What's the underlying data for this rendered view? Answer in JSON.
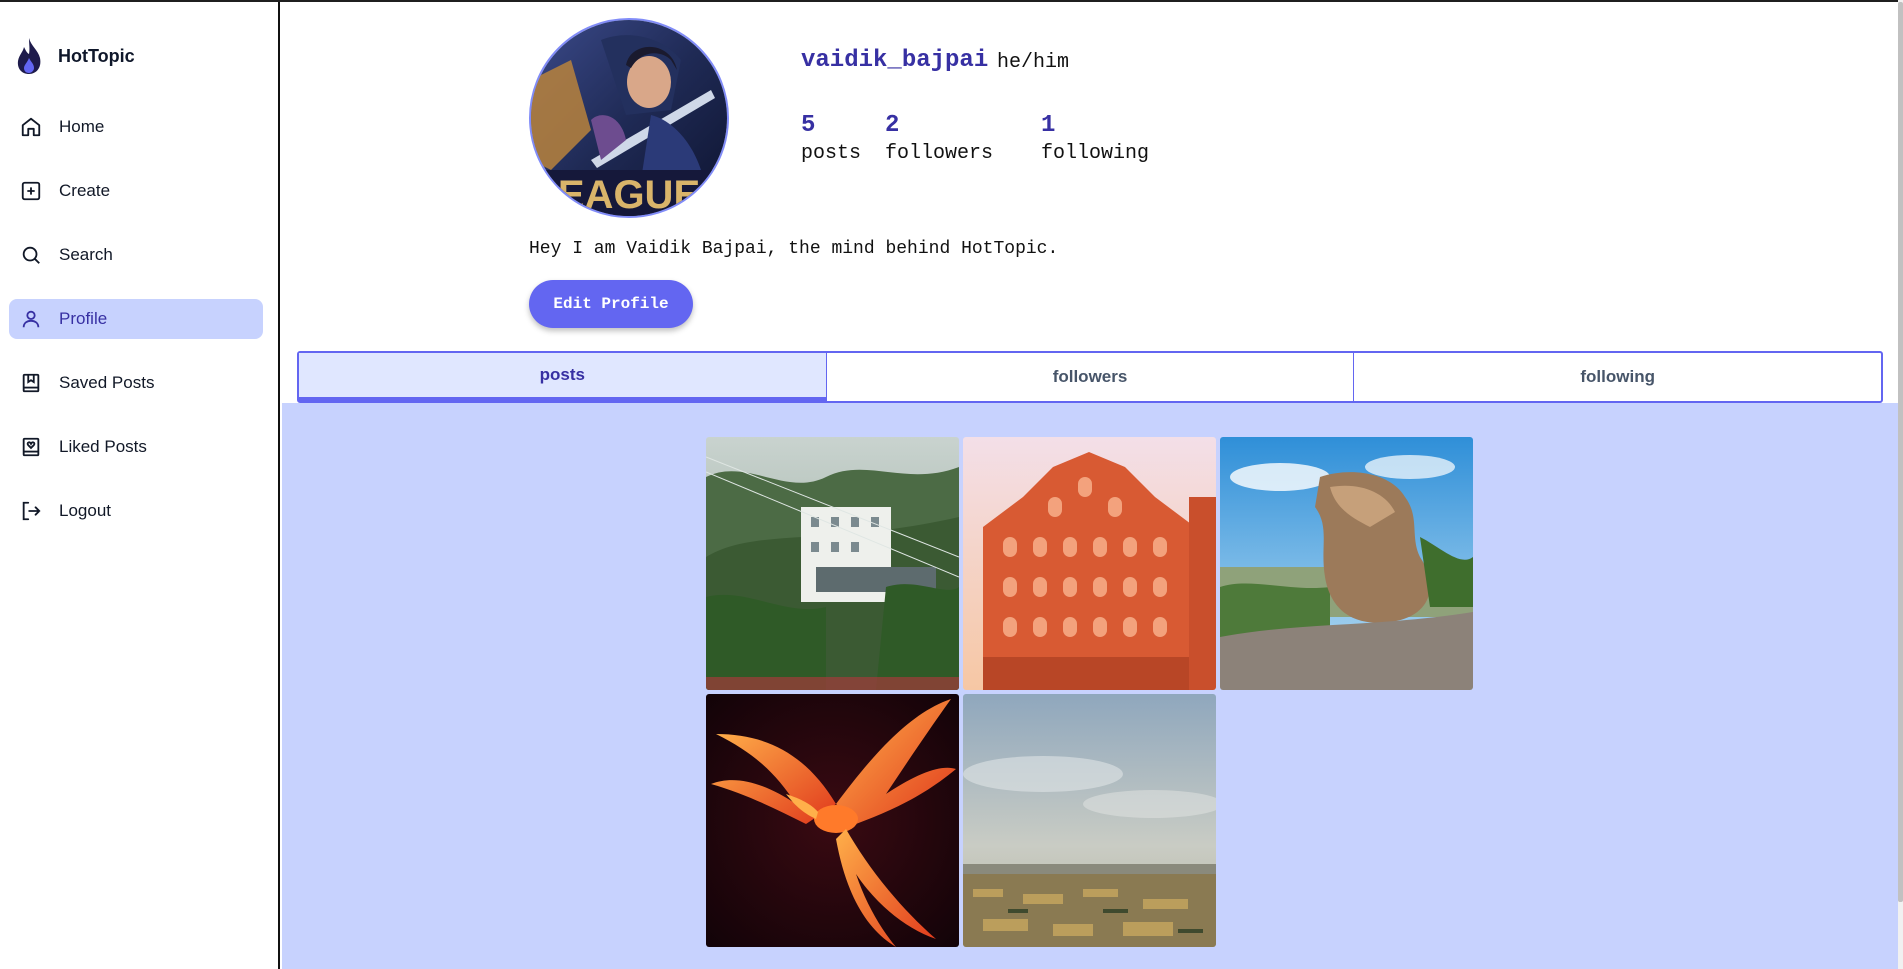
{
  "app": {
    "name": "HotTopic",
    "accent": "#6366f1",
    "accent_dark": "#3730a3",
    "active_bg": "#c7d2fe"
  },
  "sidebar": {
    "items": [
      {
        "label": "Home",
        "icon": "home-icon"
      },
      {
        "label": "Create",
        "icon": "plus-square-icon"
      },
      {
        "label": "Search",
        "icon": "search-icon"
      },
      {
        "label": "Profile",
        "icon": "user-icon",
        "active": true
      },
      {
        "label": "Saved Posts",
        "icon": "bookmark-icon"
      },
      {
        "label": "Liked Posts",
        "icon": "heart-bookmark-icon"
      },
      {
        "label": "Logout",
        "icon": "logout-icon"
      }
    ]
  },
  "profile": {
    "username": "vaidik_bajpai",
    "pronouns": "he/him",
    "stats": {
      "posts_count": "5",
      "posts_label": "posts",
      "followers_count": "2",
      "followers_label": "followers",
      "following_count": "1",
      "following_label": "following"
    },
    "bio": "Hey I am Vaidik Bajpai, the mind behind HotTopic.",
    "edit_button": "Edit Profile",
    "avatar_text": "EAGUE"
  },
  "tabs": [
    {
      "label": "posts",
      "active": true
    },
    {
      "label": "followers"
    },
    {
      "label": "following"
    }
  ],
  "posts": [
    {
      "subject": "mountain-temple-photo"
    },
    {
      "subject": "hawa-mahal-photo"
    },
    {
      "subject": "rock-cliff-photo"
    },
    {
      "subject": "phoenix-bird-image"
    },
    {
      "subject": "plains-landscape-photo"
    }
  ]
}
